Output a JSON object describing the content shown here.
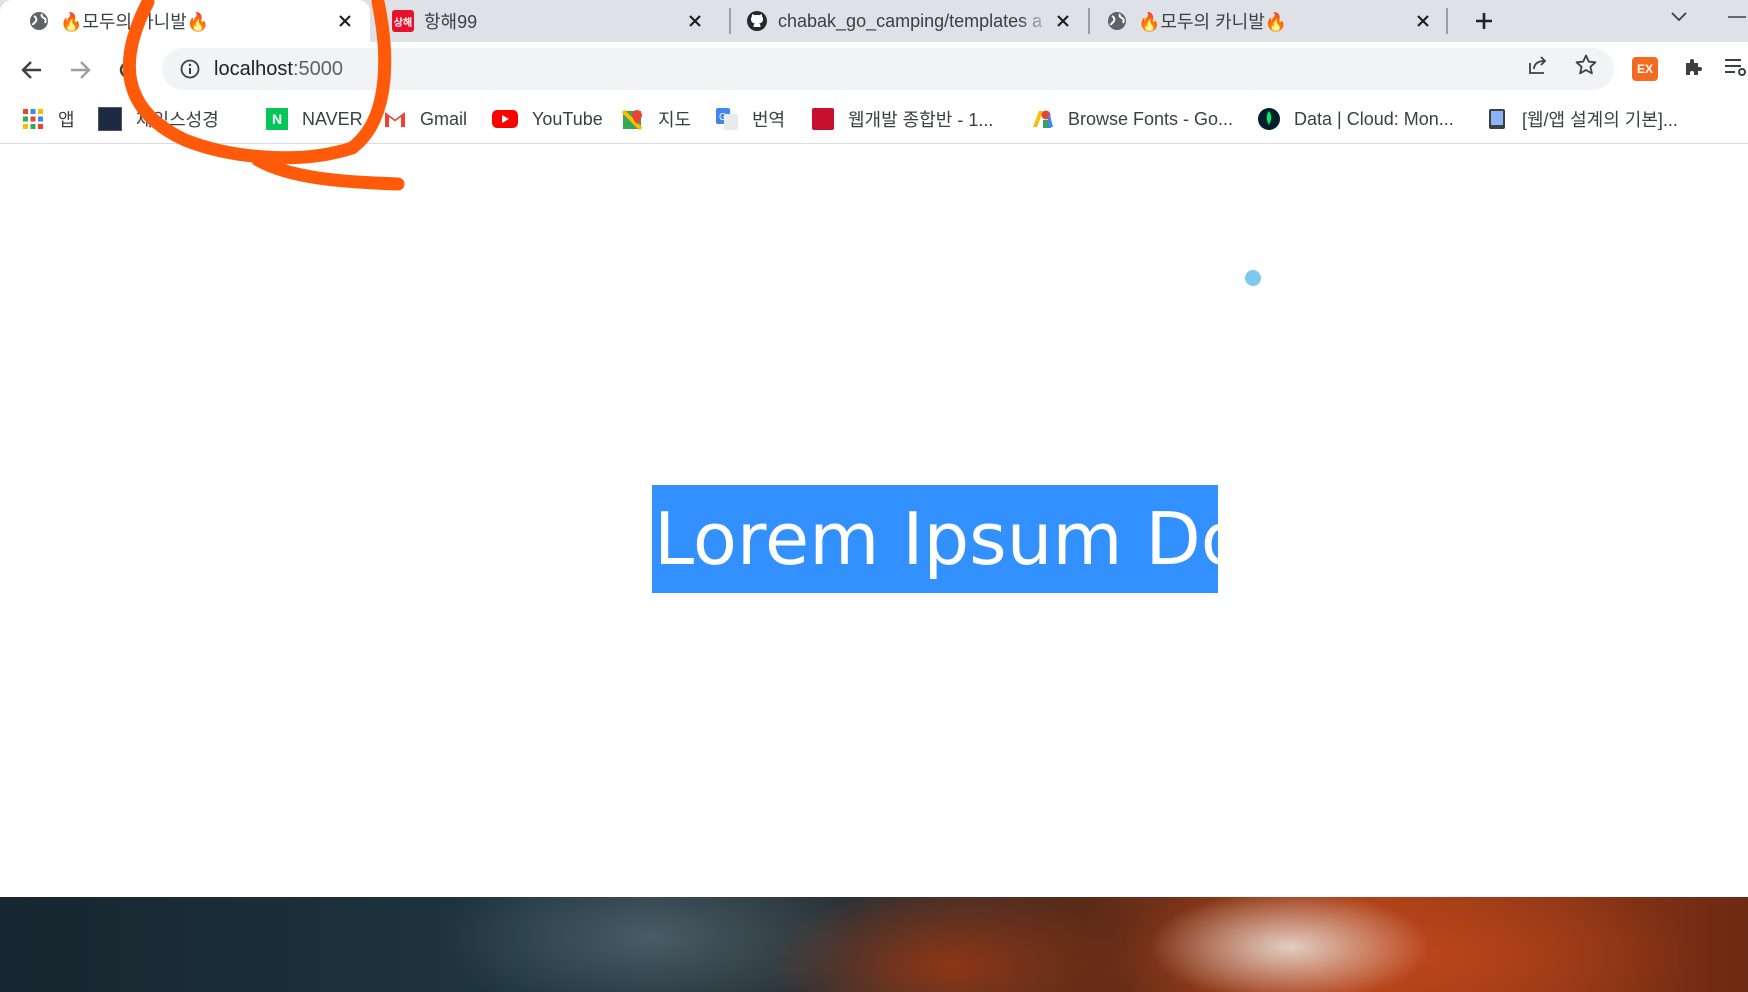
{
  "browser": {
    "tabs": [
      {
        "title": "🔥모두의 카니발🔥",
        "icon": "globe-icon",
        "active": true
      },
      {
        "title": "항해99",
        "icon": "hanghae-logo-icon",
        "favicon_text": "상해",
        "active": false
      },
      {
        "title": "chabak_go_camping/templates a",
        "icon": "github-icon",
        "active": false
      },
      {
        "title": "🔥모두의 카니발🔥",
        "icon": "globe-icon",
        "active": false
      }
    ],
    "address": {
      "host": "localhost",
      "port": ":5000"
    },
    "extension_badge": "EX",
    "bookmarks": [
      {
        "label": "앱",
        "icon": "apps-grid-icon"
      },
      {
        "label": "제임스성경",
        "icon": "holy-bible-icon"
      },
      {
        "label": "NAVER",
        "icon": "naver-icon"
      },
      {
        "label": "Gmail",
        "icon": "gmail-icon"
      },
      {
        "label": "YouTube",
        "icon": "youtube-icon"
      },
      {
        "label": "지도",
        "icon": "maps-icon"
      },
      {
        "label": "번역",
        "icon": "translate-icon"
      },
      {
        "label": "웹개발 종합반 - 1...",
        "icon": "book-icon"
      },
      {
        "label": "Browse Fonts - Go...",
        "icon": "google-fonts-icon"
      },
      {
        "label": "Data | Cloud: Mon...",
        "icon": "mongodb-leaf-icon"
      },
      {
        "label": "[웹/앱 설계의 기본]...",
        "icon": "tablet-icon"
      }
    ]
  },
  "page": {
    "hero_text": "Lorem Ipsum Dolo",
    "hero_selection_color": "#3390ff"
  },
  "colors": {
    "annotation": "#ff5a0a",
    "tabstrip": "#dee1e6",
    "dot": "#7cc8ef"
  }
}
